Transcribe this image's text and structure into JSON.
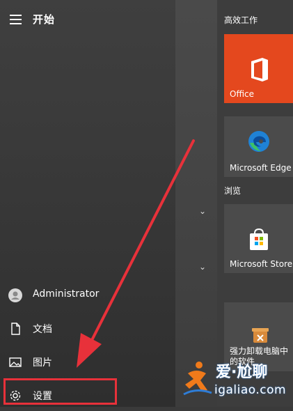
{
  "header": {
    "title": "开始",
    "menu_icon": "hamburger-icon"
  },
  "groups": {
    "productivity": "高效工作",
    "browse": "浏览"
  },
  "tiles": [
    {
      "label": "Office",
      "icon": "office-icon",
      "bg": "#e4481e"
    },
    {
      "label": "Microsoft Edge",
      "icon": "edge-icon",
      "bg": "#4b4b4b"
    },
    {
      "label": "Microsoft Store",
      "icon": "store-icon",
      "bg": "#4b4b4b"
    },
    {
      "label": "强力卸载电脑中的软件",
      "icon": "uninstall-icon",
      "bg": "#4b4b4b"
    }
  ],
  "nav": {
    "user": {
      "label": "Administrator",
      "icon": "user-avatar-icon"
    },
    "documents": {
      "label": "文档",
      "icon": "document-icon"
    },
    "pictures": {
      "label": "图片",
      "icon": "pictures-icon"
    },
    "settings": {
      "label": "设置",
      "icon": "gear-icon"
    }
  },
  "watermark": {
    "line1": "爱·尬聊",
    "line2": "igaliao.com"
  },
  "colors": {
    "highlight_box": "#e8313a",
    "arrow": "#e8313a",
    "office_tile": "#e4481e"
  }
}
